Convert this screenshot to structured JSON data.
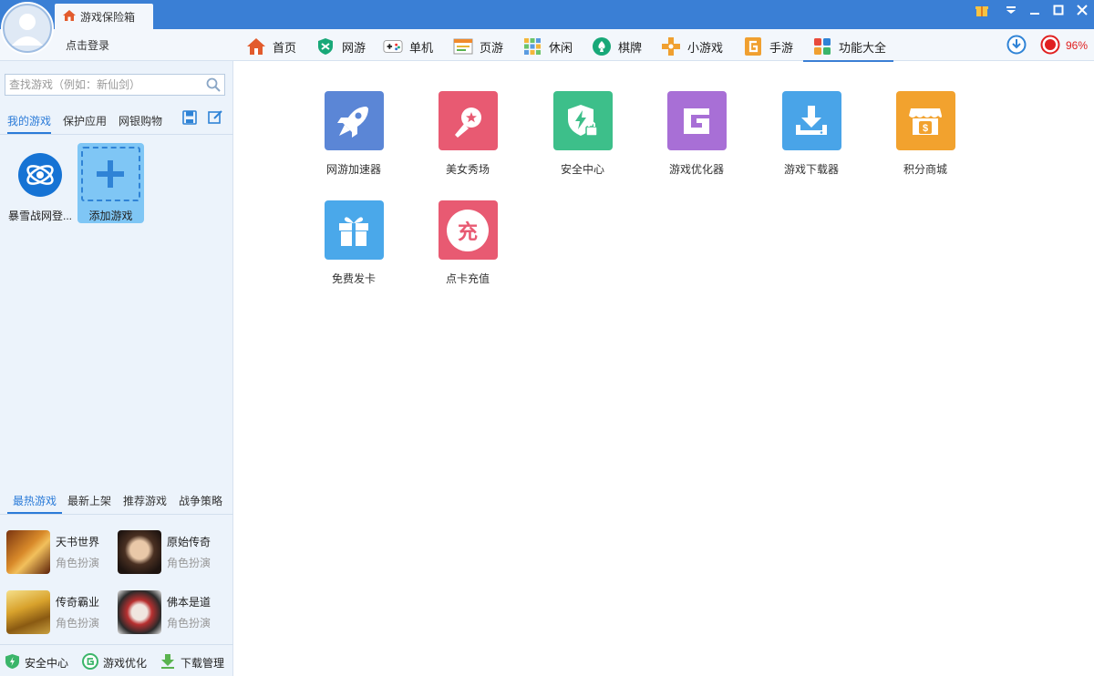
{
  "window": {
    "tab_title": "游戏保险箱",
    "login_text": "点击登录",
    "percent": "96%"
  },
  "nav": [
    {
      "label": "首页",
      "icon": "home-icon"
    },
    {
      "label": "网游",
      "icon": "shield-icon"
    },
    {
      "label": "单机",
      "icon": "gamepad-icon"
    },
    {
      "label": "页游",
      "icon": "webpage-icon"
    },
    {
      "label": "休闲",
      "icon": "casual-grid-icon"
    },
    {
      "label": "棋牌",
      "icon": "spade-icon"
    },
    {
      "label": "小游戏",
      "icon": "dpad-icon"
    },
    {
      "label": "手游",
      "icon": "mobile-g-icon"
    },
    {
      "label": "功能大全",
      "icon": "apps-grid-icon",
      "active": true
    }
  ],
  "sidebar": {
    "search_placeholder": "查找游戏（例如：新仙剑）",
    "tabs": [
      "我的游戏",
      "保护应用",
      "网银购物"
    ],
    "my_games": [
      {
        "label": "暴雪战网登...",
        "icon": "battlenet-icon"
      },
      {
        "label": "添加游戏",
        "icon": "plus-icon"
      }
    ],
    "hot_tabs": [
      "最热游戏",
      "最新上架",
      "推荐游戏",
      "战争策略"
    ],
    "hot_games": [
      {
        "name": "天书世界",
        "genre": "角色扮演"
      },
      {
        "name": "原始传奇",
        "genre": "角色扮演"
      },
      {
        "name": "传奇霸业",
        "genre": "角色扮演"
      },
      {
        "name": "佛本是道",
        "genre": "角色扮演"
      }
    ],
    "bottom": [
      {
        "label": "安全中心",
        "icon": "shield-bolt-icon"
      },
      {
        "label": "游戏优化",
        "icon": "g-circle-icon"
      },
      {
        "label": "下载管理",
        "icon": "download-arrow-icon"
      }
    ]
  },
  "features": [
    {
      "label": "网游加速器",
      "icon": "rocket-icon",
      "color": "#5b86d6"
    },
    {
      "label": "美女秀场",
      "icon": "microphone-icon",
      "color": "#e85a72"
    },
    {
      "label": "安全中心",
      "icon": "shield-lock-icon",
      "color": "#3dbf8a"
    },
    {
      "label": "游戏优化器",
      "icon": "g-logo-icon",
      "color": "#a86fd6"
    },
    {
      "label": "游戏下载器",
      "icon": "download-icon",
      "color": "#49a4e8"
    },
    {
      "label": "积分商城",
      "icon": "store-icon",
      "color": "#f2a22e"
    },
    {
      "label": "免费发卡",
      "icon": "gift-icon",
      "color": "#4aa8ea"
    },
    {
      "label": "点卡充值",
      "icon": "recharge-icon",
      "color": "#e85a72",
      "glyph": "充"
    }
  ]
}
